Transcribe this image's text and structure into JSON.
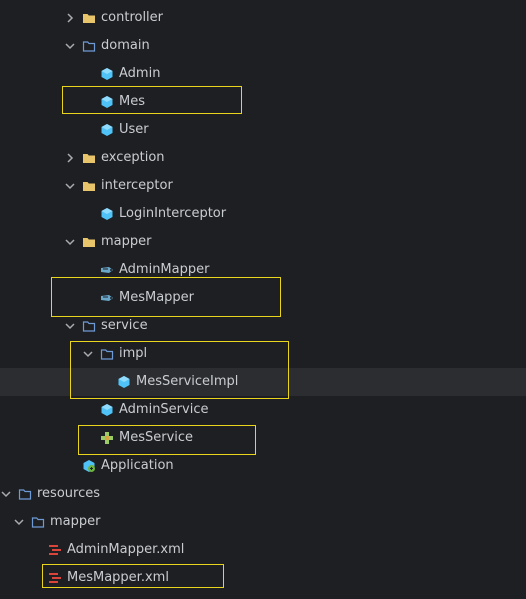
{
  "tree": {
    "controller": "controller",
    "domain": "domain",
    "admin": "Admin",
    "mes": "Mes",
    "user": "User",
    "exception": "exception",
    "interceptor": "interceptor",
    "login_interceptor": "LoginInterceptor",
    "mapper": "mapper",
    "admin_mapper": "AdminMapper",
    "mes_mapper": "MesMapper",
    "service": "service",
    "impl": "impl",
    "mes_service_impl": "MesServiceImpl",
    "admin_service": "AdminService",
    "mes_service": "MesService",
    "application": "Application",
    "resources": "resources",
    "resources_mapper": "mapper",
    "admin_mapper_xml": "AdminMapper.xml",
    "mes_mapper_xml": "MesMapper.xml"
  },
  "colors": {
    "background": "#1e1f22",
    "selected_row": "#2b2d30",
    "highlight_border": "#e9d51c",
    "class_icon": "#4fc3f7",
    "folder_package": "#e8c46a",
    "folder_outline": "#6e9bd6",
    "xml_icon": "#d9443b",
    "interface_icon": "#9ccc65"
  }
}
